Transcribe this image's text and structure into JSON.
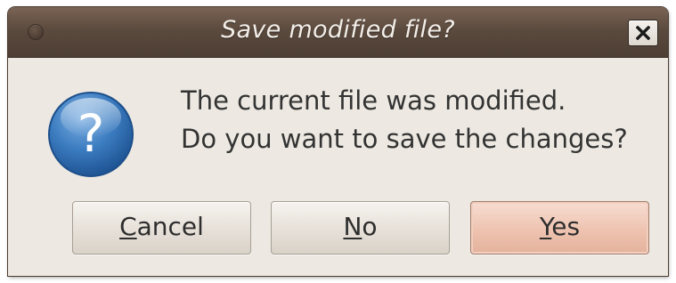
{
  "dialog": {
    "title": "Save modified file?",
    "message_line1": "The current file was modified.",
    "message_line2": "Do you want to save the changes?",
    "icon": "question-icon",
    "close_icon": "close-icon"
  },
  "buttons": {
    "cancel": {
      "mnemonic": "C",
      "rest": "ancel"
    },
    "no": {
      "mnemonic": "N",
      "rest": "o"
    },
    "yes": {
      "mnemonic": "Y",
      "rest": "es"
    }
  },
  "colors": {
    "titlebar": "#5b4a3e",
    "window_bg": "#ede9e2",
    "default_button": "#eec3b0",
    "icon_blue": "#2f6fb2"
  }
}
